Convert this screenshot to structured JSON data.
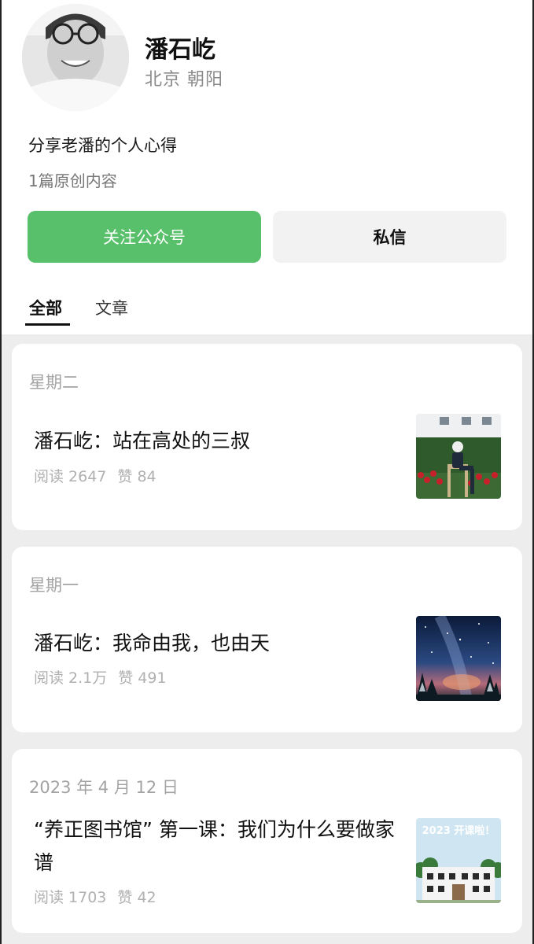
{
  "profile": {
    "name": "潘石屹",
    "location": "北京 朝阳",
    "bio": "分享老潘的个人心得",
    "original_count": "1篇原创内容"
  },
  "actions": {
    "follow_label": "关注公众号",
    "message_label": "私信"
  },
  "tabs": [
    {
      "label": "全部",
      "active": true
    },
    {
      "label": "文章",
      "active": false
    }
  ],
  "articles": [
    {
      "date": "星期二",
      "title": "潘石屹：站在高处的三叔",
      "reads": "阅读 2647",
      "likes": "赞 84",
      "thumbnail": "man-sitting-in-garden-photo"
    },
    {
      "date": "星期一",
      "title": "潘石屹：我命由我，也由天",
      "reads": "阅读 2.1万",
      "likes": "赞 491",
      "thumbnail": "milky-way-night-sky-photo"
    },
    {
      "date": "2023 年 4 月 12 日",
      "title": "“养正图书馆” 第一课：我们为什么要做家谱",
      "reads": "阅读 1703",
      "likes": "赞 42",
      "thumbnail": "library-building-poster",
      "thumbnail_text": "2023 开课啦！"
    }
  ],
  "colors": {
    "accent_green": "#58c06a",
    "page_bg": "#ededed",
    "muted_text": "#a3a3a3"
  }
}
